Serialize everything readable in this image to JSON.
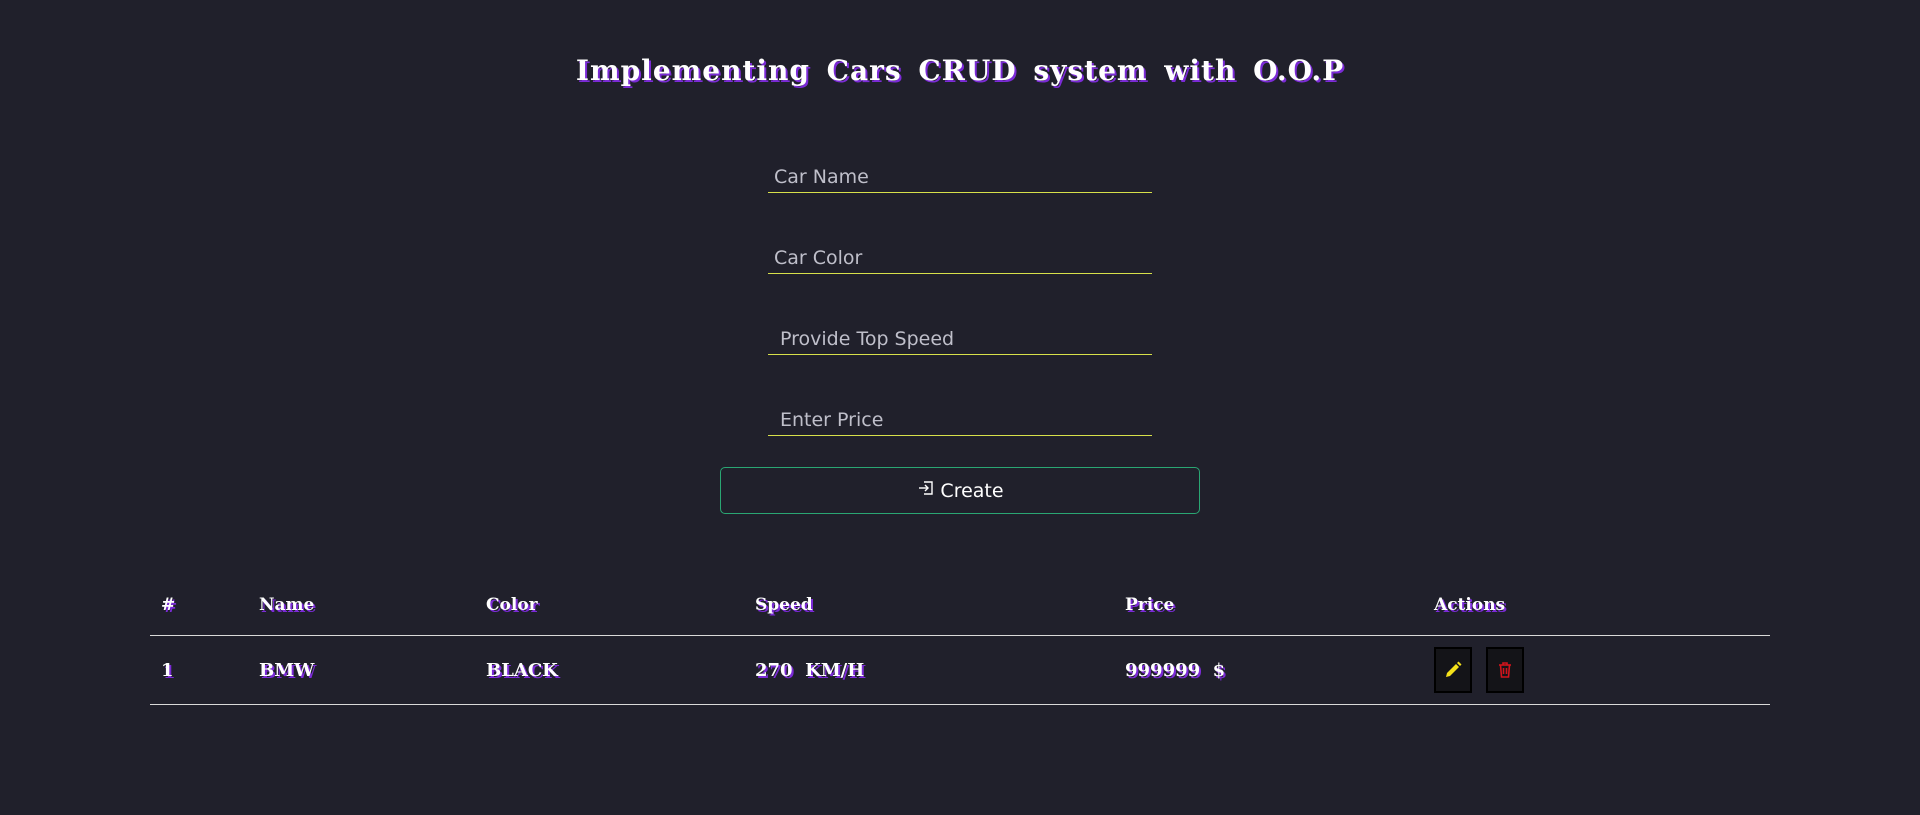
{
  "header": {
    "title": "Implementing Cars CRUD system with O.O.P"
  },
  "form": {
    "car_name_placeholder": "Car Name",
    "car_color_placeholder": "Car Color",
    "top_speed_placeholder": "Provide Top Speed",
    "price_placeholder": "Enter Price",
    "create_label": "Create"
  },
  "table": {
    "columns": [
      "#",
      "Name",
      "Color",
      "Speed",
      "Price",
      "Actions"
    ],
    "rows": [
      {
        "num": "1",
        "name": "BMW",
        "color": "BLACK",
        "speed": "270  KM/H",
        "price": "999999  $"
      }
    ]
  },
  "icons": {
    "create": "sign-in-icon",
    "edit": "pencil-icon",
    "delete": "trash-icon"
  },
  "colors": {
    "background": "#20202b",
    "accent_underline": "#d7e04a",
    "create_border": "#2aa673",
    "title_shadow": "#7b2bd6",
    "edit_icon": "#f5e11a",
    "delete_icon": "#d0141c"
  }
}
